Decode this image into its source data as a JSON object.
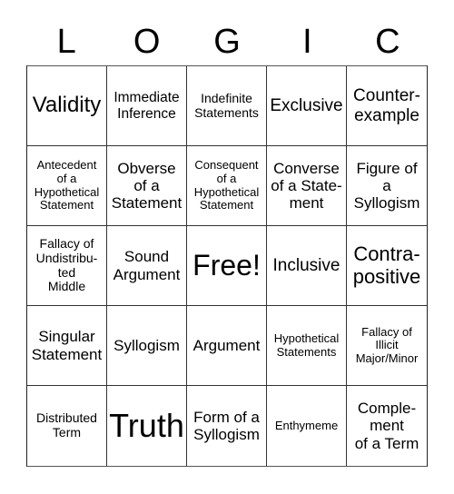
{
  "title_letters": [
    "L",
    "O",
    "G",
    "I",
    "C"
  ],
  "cells": [
    "Validity",
    "Immediate\nInference",
    "Indefinite\nStatements",
    "Exclusive",
    "Counter-\nexample",
    "Antecedent\nof a\nHypothetical\nStatement",
    "Obverse\nof a\nStatement",
    "Consequent\nof a\nHypothetical\nStatement",
    "Converse\nof a State-\nment",
    "Figure of\na\nSyllogism",
    "Fallacy of\nUndistribu-\nted\nMiddle",
    "Sound\nArgument",
    "Free!",
    "Inclusive",
    "Contra-\npositive",
    "Singular\nStatement",
    "Syllogism",
    "Argument",
    "Hypothetical\nStatements",
    "Fallacy of\nIllicit\nMajor/Minor",
    "Distributed\nTerm",
    "Truth",
    "Form of a\nSyllogism",
    "Enthymeme",
    "Comple-\nment\nof a Term"
  ]
}
